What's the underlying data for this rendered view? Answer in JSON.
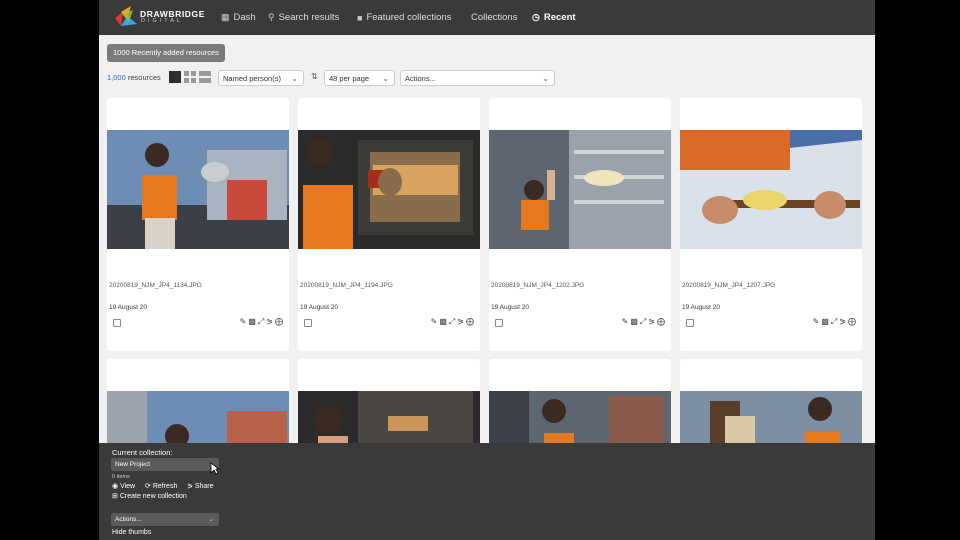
{
  "nav": {
    "brand": "DRAWBRIDGE",
    "brand_sub": "DIGITAL",
    "items": [
      {
        "label": "Dash",
        "icon": "grid-icon"
      },
      {
        "label": "Search results",
        "icon": "search-icon"
      },
      {
        "label": "Featured collections",
        "icon": "folder-icon"
      },
      {
        "label": "Collections",
        "icon": ""
      },
      {
        "label": "Recent",
        "icon": "clock-icon"
      }
    ]
  },
  "header": {
    "recent_pill": "1000 Recently added resources",
    "resource_count": "1,000",
    "resource_label": "resources",
    "filter_select": "Named person(s)",
    "per_page_select": "48 per page",
    "actions_select": "Actions..."
  },
  "colors": {
    "topbar": "#3a3a3a",
    "link": "#2a6ebb",
    "background": "#f1f1f1"
  },
  "resources": [
    {
      "filename": "20200819_NJM_JP4_1134.JPG",
      "date": "19 August 20"
    },
    {
      "filename": "20200819_NJM_JP4_1194.JPG",
      "date": "19 August 20"
    },
    {
      "filename": "20200819_NJM_JP4_1202.JPG",
      "date": "19 August 20"
    },
    {
      "filename": "20200819_NJM_JP4_1207.JPG",
      "date": "19 August 20"
    }
  ],
  "collection_bar": {
    "label": "Current collection:",
    "selected": "New Project",
    "items": "0 items",
    "view": "View",
    "refresh": "Refresh",
    "share": "Share",
    "create": "Create new collection",
    "actions": "Actions...",
    "hide_thumbs": "Hide thumbs"
  }
}
